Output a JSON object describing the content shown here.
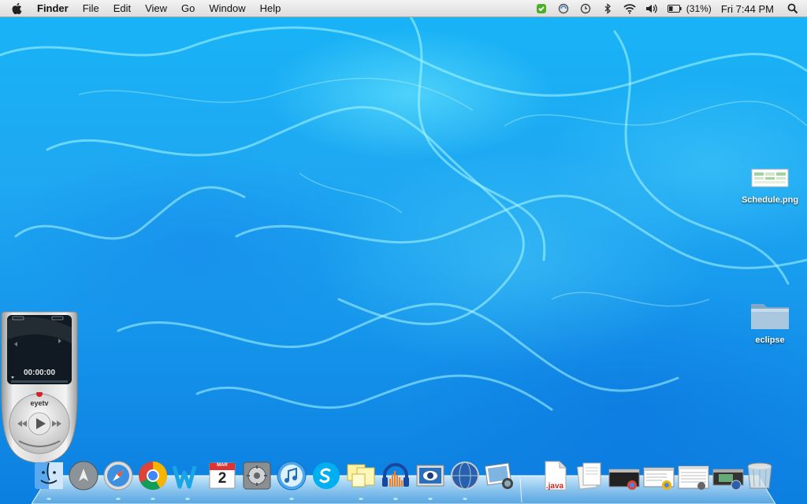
{
  "menubar": {
    "app_name": "Finder",
    "menus": [
      "File",
      "Edit",
      "View",
      "Go",
      "Window",
      "Help"
    ],
    "battery_text": "(31%)",
    "clock": "Fri 7:44 PM",
    "status_icons": [
      "evernote-icon",
      "sync-icon",
      "time-machine-icon",
      "bluetooth-icon",
      "wifi-icon",
      "volume-icon",
      "battery-icon",
      "spotlight-icon"
    ]
  },
  "desktop": {
    "icons": [
      {
        "label": "Schedule.png",
        "icon": "image-file-icon"
      },
      {
        "label": "eclipse",
        "icon": "folder-icon"
      }
    ]
  },
  "eyetv": {
    "time": "00:00:00",
    "brand": "eyetv"
  },
  "dock": {
    "apps": [
      "finder-icon",
      "launchpad-icon",
      "safari-icon",
      "chrome-icon",
      "word-icon",
      "calendar-icon",
      "system-preferences-icon",
      "itunes-icon",
      "skype-icon",
      "stickies-icon",
      "audacity-icon",
      "preview-icon",
      "network-utility-icon",
      "iphoto-icon"
    ],
    "calendar_day": "2",
    "calendar_month": "MAR",
    "stacks": [
      "java-file-icon",
      "documents-stack-icon",
      "terminal-window-icon",
      "chrome-window-icon",
      "chrome-window-icon-2",
      "document-window-icon",
      "video-window-icon",
      "trash-icon"
    ],
    "java_label": ".java"
  }
}
